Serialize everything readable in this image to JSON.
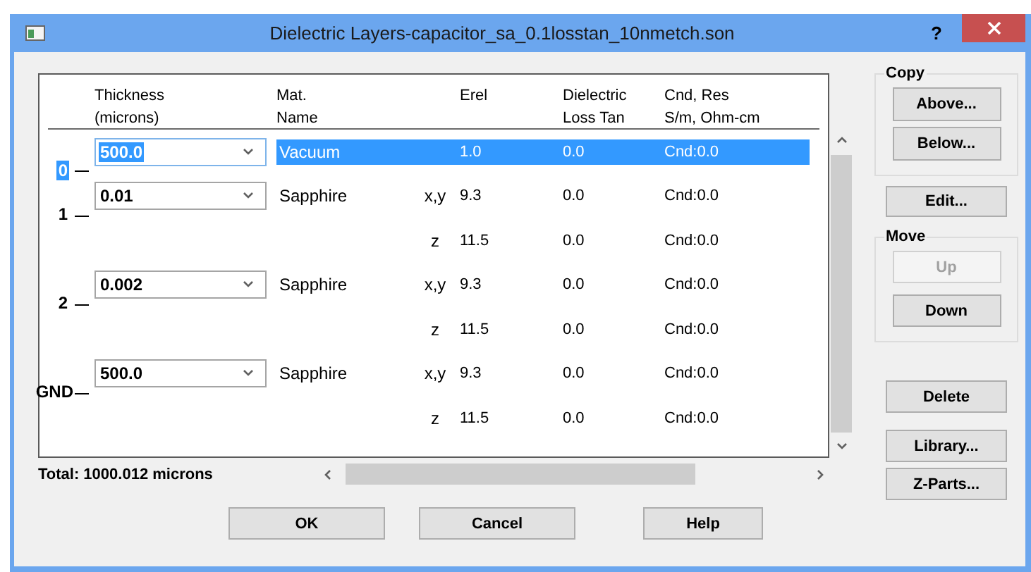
{
  "window": {
    "title": "Dielectric Layers-capacitor_sa_0.1losstan_10nmetch.son",
    "help_glyph": "?"
  },
  "table": {
    "columns": [
      {
        "lines": [
          "Thickness",
          "(microns)"
        ]
      },
      {
        "lines": [
          "Mat.",
          "Name"
        ]
      },
      {
        "lines": [
          "Erel"
        ]
      },
      {
        "lines": [
          "Dielectric",
          "Loss Tan"
        ]
      },
      {
        "lines": [
          "Cnd, Res",
          "S/m, Ohm-cm"
        ]
      }
    ],
    "layers": [
      {
        "label": "0",
        "thickness": "500.0",
        "material": "Vacuum",
        "selected": true,
        "rows": [
          {
            "erel": "1.0",
            "loss_tan": "0.0",
            "cnd_res": "Cnd:0.0"
          }
        ]
      },
      {
        "label": "1",
        "thickness": "0.01",
        "material": "Sapphire",
        "selected": false,
        "rows": [
          {
            "axis": "x,y",
            "erel": "9.3",
            "loss_tan": "0.0",
            "cnd_res": "Cnd:0.0"
          },
          {
            "axis": "z",
            "erel": "11.5",
            "loss_tan": "0.0",
            "cnd_res": "Cnd:0.0"
          }
        ]
      },
      {
        "label": "2",
        "thickness": "0.002",
        "material": "Sapphire",
        "selected": false,
        "rows": [
          {
            "axis": "x,y",
            "erel": "9.3",
            "loss_tan": "0.0",
            "cnd_res": "Cnd:0.0"
          },
          {
            "axis": "z",
            "erel": "11.5",
            "loss_tan": "0.0",
            "cnd_res": "Cnd:0.0"
          }
        ]
      },
      {
        "label": "GND",
        "thickness": "500.0",
        "material": "Sapphire",
        "selected": false,
        "rows": [
          {
            "axis": "x,y",
            "erel": "9.3",
            "loss_tan": "0.0",
            "cnd_res": "Cnd:0.0"
          },
          {
            "axis": "z",
            "erel": "11.5",
            "loss_tan": "0.0",
            "cnd_res": "Cnd:0.0"
          }
        ]
      }
    ]
  },
  "total": "Total: 1000.012 microns",
  "side_panel": {
    "copy": {
      "title": "Copy",
      "buttons": [
        {
          "label": "Above...",
          "disabled": false
        },
        {
          "label": "Below...",
          "disabled": false
        }
      ]
    },
    "edit_button": "Edit...",
    "move": {
      "title": "Move",
      "buttons": [
        {
          "label": "Up",
          "disabled": true
        },
        {
          "label": "Down",
          "disabled": false
        }
      ]
    },
    "buttons": [
      {
        "label": "Delete",
        "disabled": false
      },
      {
        "label": "Library...",
        "disabled": false
      },
      {
        "label": "Z-Parts...",
        "disabled": false
      }
    ]
  },
  "dialog_buttons": [
    "OK",
    "Cancel",
    "Help"
  ]
}
